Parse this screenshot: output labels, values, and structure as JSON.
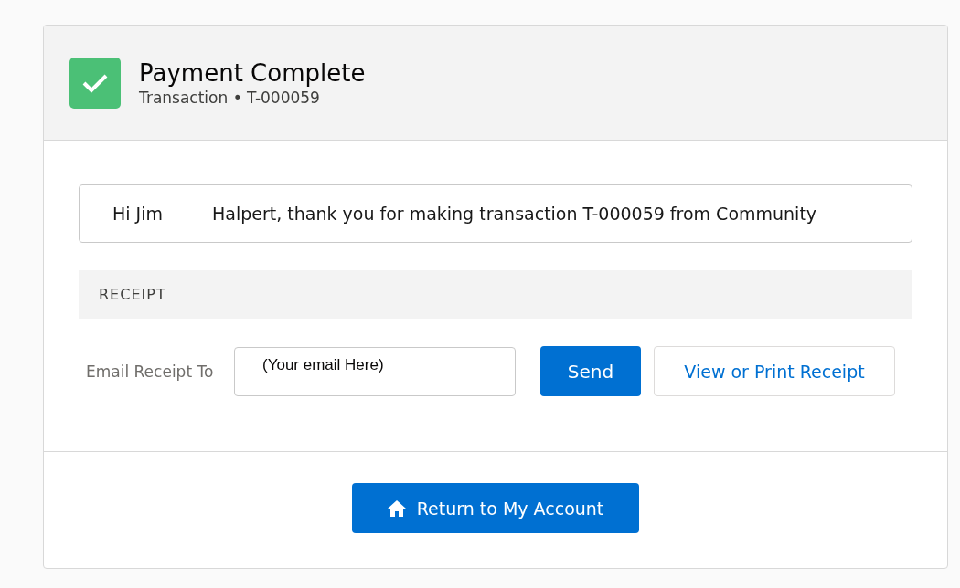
{
  "header": {
    "title": "Payment Complete",
    "subtitle": "Transaction • T-000059"
  },
  "message": {
    "greeting": "Hi Jim",
    "text": "Halpert, thank you for making transaction T-000059 from Community"
  },
  "receipt": {
    "section_title": "RECEIPT",
    "email_label": "Email Receipt To",
    "email_value": "(Your email Here)",
    "send_button": "Send",
    "view_button": "View or Print Receipt"
  },
  "footer": {
    "button": "Return to My Account"
  }
}
